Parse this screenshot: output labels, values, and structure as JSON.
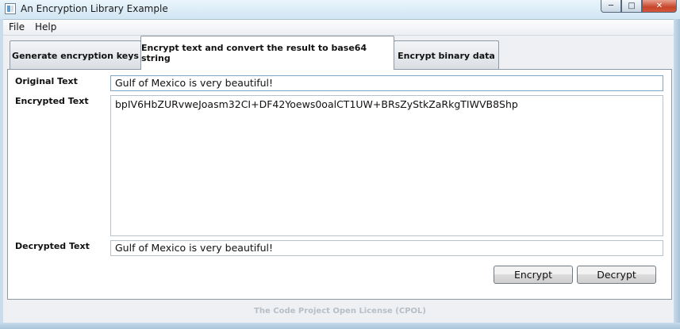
{
  "window": {
    "title": "An Encryption Library Example"
  },
  "menu": {
    "items": [
      {
        "label": "File"
      },
      {
        "label": "Help"
      }
    ]
  },
  "tabs": [
    {
      "label": "Generate encryption keys",
      "active": false
    },
    {
      "label": "Encrypt text and convert the result to base64 string",
      "active": true
    },
    {
      "label": "Encrypt binary data",
      "active": false
    }
  ],
  "form": {
    "original_label": "Original Text",
    "original_value": "Gulf of Mexico is very beautiful!",
    "encrypted_label": "Encrypted Text",
    "encrypted_value": "bpIV6HbZURvweJoasm32CI+DF42Yoews0oalCT1UW+BRsZyStkZaRkgTIWVB8Shp",
    "decrypted_label": "Decrypted Text",
    "decrypted_value": "Gulf of Mexico is very beautiful!"
  },
  "buttons": {
    "encrypt": "Encrypt",
    "decrypt": "Decrypt"
  },
  "footer": {
    "license": "The Code Project Open License (CPOL)"
  },
  "colors": {
    "title_bar": "#d2e6f3",
    "close_button": "#c6452b",
    "footer_text": "#b8bec6"
  }
}
